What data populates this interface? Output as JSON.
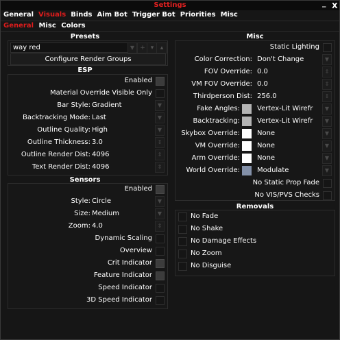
{
  "window": {
    "title": "Settings",
    "minimize": "_",
    "close": "X"
  },
  "tabs": [
    "General",
    "Visuals",
    "Binds",
    "Aim Bot",
    "Trigger Bot",
    "Priorities",
    "Misc"
  ],
  "subtabs": [
    "General",
    "Misc",
    "Colors"
  ],
  "presets": {
    "header": "Presets",
    "value": "way red",
    "button": "Configure Render Groups"
  },
  "esp": {
    "header": "ESP",
    "enabled": "Enabled",
    "material_override": "Material Override Visible Only",
    "bar_style_label": "Bar Style:",
    "bar_style_value": "Gradient",
    "backtracking_label": "Backtracking Mode:",
    "backtracking_value": "Last",
    "outline_quality_label": "Outline Quality:",
    "outline_quality_value": "High",
    "outline_thickness_label": "Outline Thickness:",
    "outline_thickness_value": "3.0",
    "outline_render_label": "Outline Render Dist:",
    "outline_render_value": "4096",
    "text_render_label": "Text Render Dist:",
    "text_render_value": "4096"
  },
  "sensors": {
    "header": "Sensors",
    "enabled": "Enabled",
    "style_label": "Style:",
    "style_value": "Circle",
    "size_label": "Size:",
    "size_value": "Medium",
    "zoom_label": "Zoom:",
    "zoom_value": "4.0",
    "dynamic_scaling": "Dynamic Scaling",
    "overview": "Overview",
    "crit_indicator": "Crit Indicator",
    "feature_indicator": "Feature Indicator",
    "speed_indicator": "Speed Indicator",
    "speed3d_indicator": "3D Speed Indicator"
  },
  "misc": {
    "header": "Misc",
    "static_lighting": "Static Lighting",
    "color_correction_label": "Color Correction:",
    "color_correction_value": "Don't Change",
    "fov_label": "FOV Override:",
    "fov_value": "0.0",
    "vm_fov_label": "VM FOV Override:",
    "vm_fov_value": "0.0",
    "thirdperson_label": "Thirdperson Dist:",
    "thirdperson_value": "256.0",
    "fake_angles_label": "Fake Angles:",
    "fake_angles_value": "Vertex-Lit Wirefr",
    "backtracking_label": "Backtracking:",
    "backtracking_value": "Vertex-Lit Wirefr",
    "skybox_label": "Skybox Override:",
    "skybox_value": "None",
    "vm_override_label": "VM Override:",
    "vm_override_value": "None",
    "arm_override_label": "Arm Override:",
    "arm_override_value": "None",
    "world_override_label": "World Override:",
    "world_override_value": "Modulate",
    "no_static_prop_fade": "No Static Prop Fade",
    "no_vis_pvs": "No VIS/PVS Checks",
    "swatch_grey": "#b4b4b4",
    "swatch_white": "#ffffff",
    "swatch_blue": "#8390a8"
  },
  "removals": {
    "header": "Removals",
    "items": [
      "No Fade",
      "No Shake",
      "No Damage Effects",
      "No Zoom",
      "No Disguise"
    ]
  },
  "colors": {
    "accent": "#e01c1c"
  }
}
